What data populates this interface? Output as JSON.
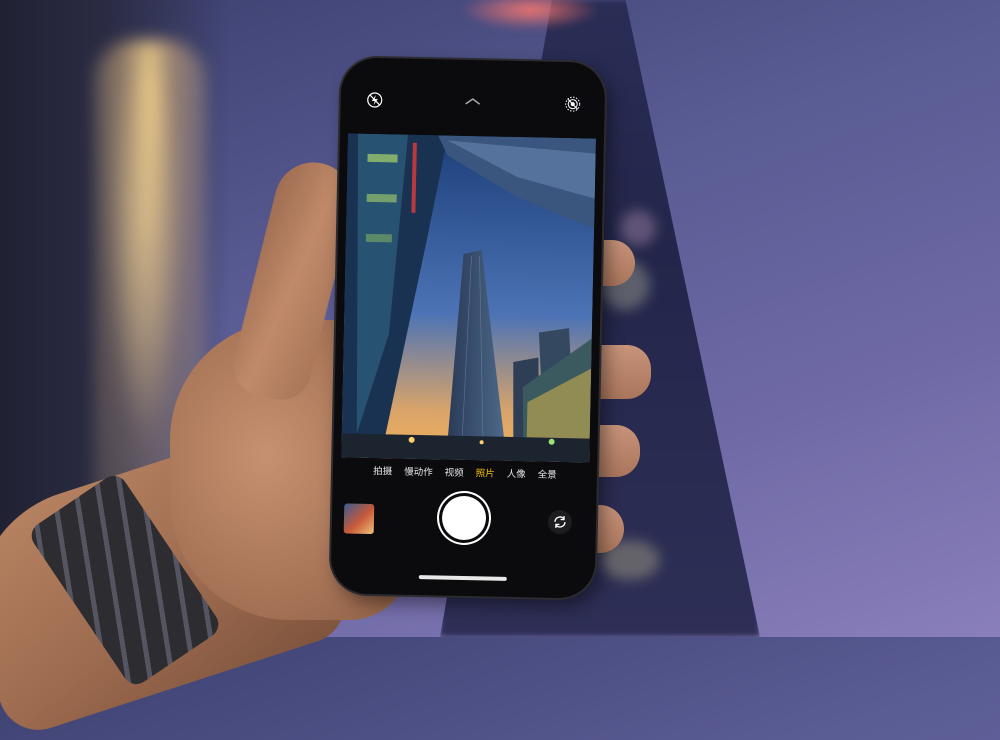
{
  "camera": {
    "modes": [
      {
        "label": "拍摄",
        "active": false
      },
      {
        "label": "慢动作",
        "active": false
      },
      {
        "label": "视频",
        "active": false
      },
      {
        "label": "照片",
        "active": true
      },
      {
        "label": "人像",
        "active": false
      },
      {
        "label": "全景",
        "active": false
      }
    ],
    "icons": {
      "flash": "flash-off-icon",
      "live": "live-photo-icon",
      "expand": "chevron-up-icon",
      "flip": "flip-camera-icon"
    }
  },
  "colors": {
    "active_mode": "#f5c400",
    "phone_body": "#0b0b0d"
  }
}
